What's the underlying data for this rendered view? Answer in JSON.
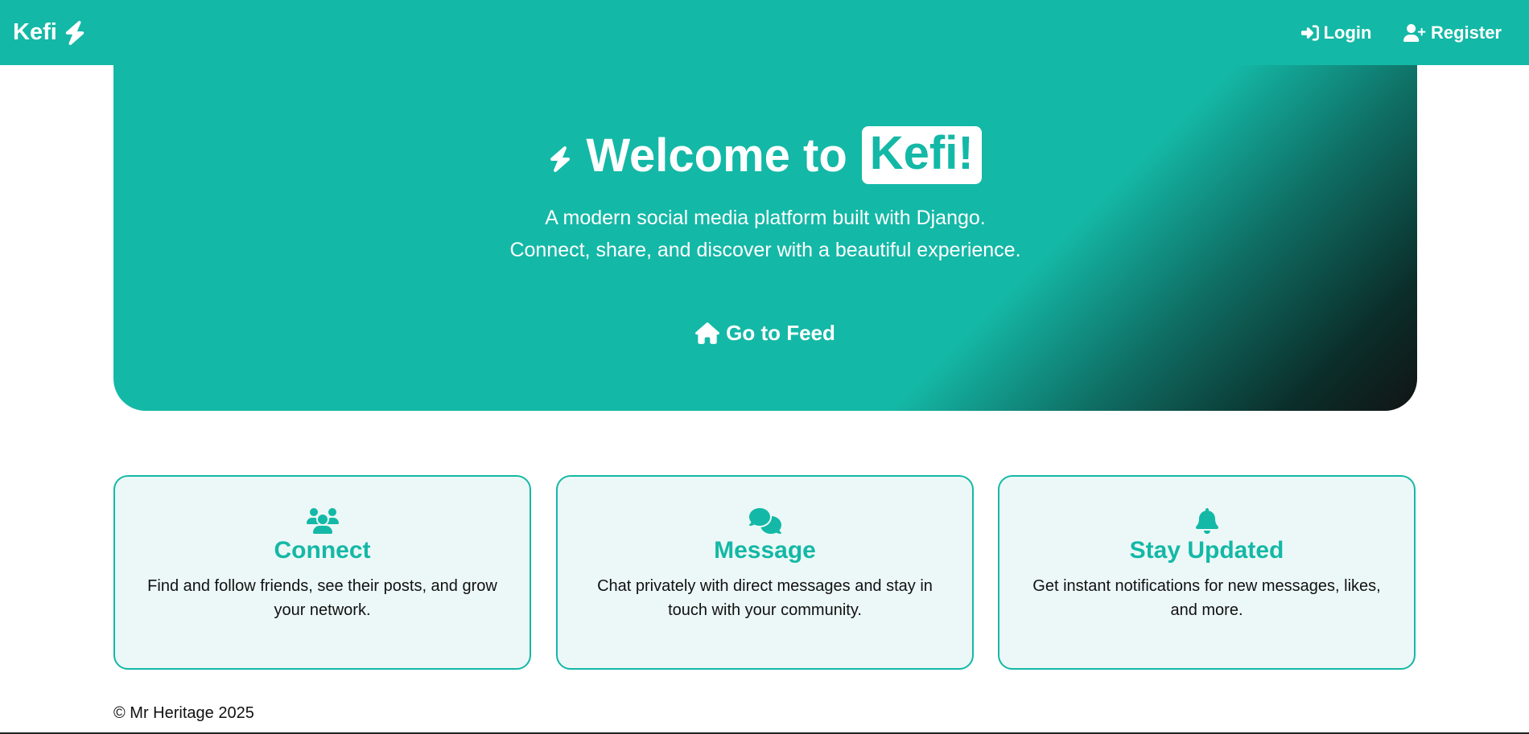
{
  "navbar": {
    "brand": "Kefi",
    "brand_icon": "bolt-icon",
    "login_label": "Login",
    "login_icon": "sign-in-icon",
    "register_label": "Register",
    "register_icon": "user-plus-icon"
  },
  "hero": {
    "title_prefix": "Welcome to",
    "title_brand": "Kefi!",
    "subtitle_line1": "A modern social media platform built with Django.",
    "subtitle_line2": "Connect, share, and discover with a beautiful experience.",
    "cta_label": "Go to Feed",
    "cta_icon": "home-icon"
  },
  "features": [
    {
      "icon": "users-icon",
      "title": "Connect",
      "description": "Find and follow friends, see their posts, and grow your network."
    },
    {
      "icon": "comments-icon",
      "title": "Message",
      "description": "Chat privately with direct messages and stay in touch with your community."
    },
    {
      "icon": "bell-icon",
      "title": "Stay Updated",
      "description": "Get instant notifications for new messages, likes, and more."
    }
  ],
  "footer": {
    "copyright": "© Mr Heritage 2025"
  },
  "colors": {
    "primary": "#14b8a6",
    "card_bg": "#ecf8f7",
    "text": "#111111"
  }
}
